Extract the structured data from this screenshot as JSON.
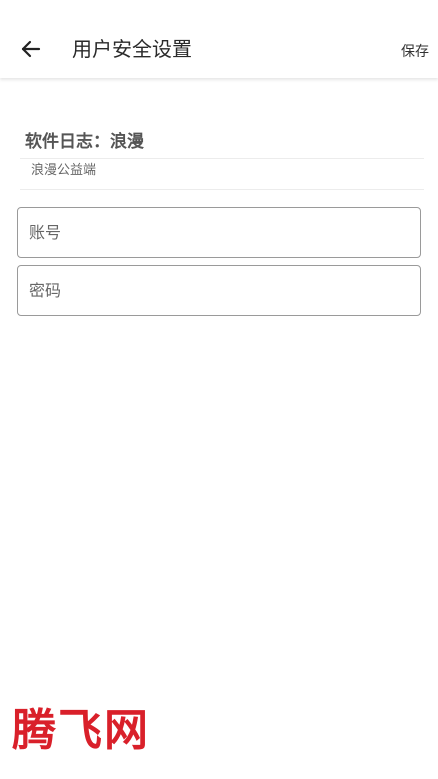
{
  "header": {
    "back_icon": "arrow-left-icon",
    "title": "用户安全设置",
    "save_label": "保存"
  },
  "log": {
    "title": "软件日志：浪漫",
    "description": "浪漫公益端"
  },
  "form": {
    "account_placeholder": "账号",
    "account_value": "",
    "password_placeholder": "密码",
    "password_value": ""
  },
  "watermark": {
    "text": "腾飞网",
    "color": "#d9202a"
  }
}
